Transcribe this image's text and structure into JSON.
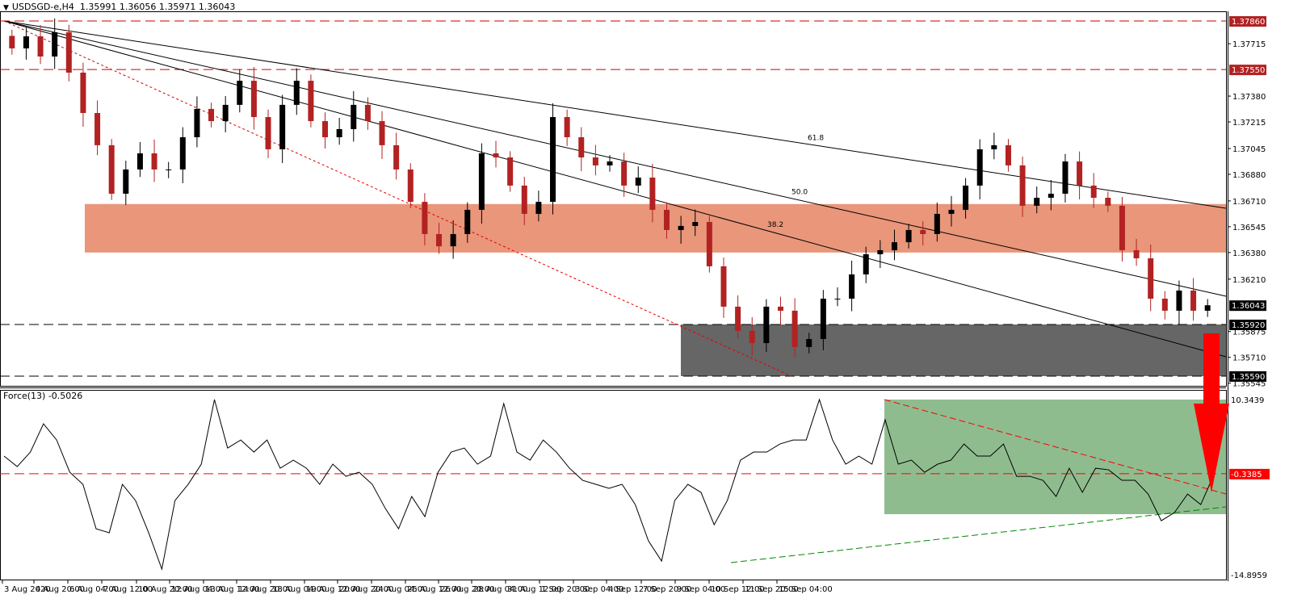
{
  "header": {
    "symbol": "USDSGD-e,H4",
    "ohlc": "1.35991 1.36056 1.35971 1.36043"
  },
  "force_header": "Force(13) -0.5026",
  "colors": {
    "bull": "#000000",
    "bear": "#b22222",
    "resistance_zone": "#e9967a",
    "support_zone": "#666666",
    "force_zone": "#8fbc8f",
    "arrow": "#ff0000"
  },
  "chart_data": [
    {
      "type": "candlestick",
      "title": "USDSGD-e,H4",
      "ylim": [
        1.35545,
        1.3786
      ],
      "y_ticks": [
        "1.37715",
        "1.37380",
        "1.37215",
        "1.37045",
        "1.36880",
        "1.36710",
        "1.36545",
        "1.36380",
        "1.36210",
        "1.35875",
        "1.35710",
        "1.35545"
      ],
      "highlighted_levels": [
        {
          "value": "1.37860",
          "style": "red-dashed"
        },
        {
          "value": "1.37550",
          "style": "red-dashed"
        },
        {
          "value": "1.36043",
          "style": "current-price"
        },
        {
          "value": "1.35920",
          "style": "black-dashed"
        },
        {
          "value": "1.35590",
          "style": "black-dashed"
        }
      ],
      "x_ticks": [
        "3 Aug 2020",
        "4 Aug 20:00",
        "6 Aug 04:00",
        "7 Aug 12:00",
        "10 Aug 20:00",
        "12 Aug 04:00",
        "13 Aug 12:00",
        "14 Aug 20:00",
        "18 Aug 04:00",
        "19 Aug 12:00",
        "20 Aug 20:00",
        "24 Aug 04:00",
        "25 Aug 12:00",
        "26 Aug 20:00",
        "28 Aug 04:00",
        "31 Aug 12:00",
        "1 Sep 20:00",
        "3 Sep 04:00",
        "4 Sep 12:00",
        "7 Sep 20:00",
        "9 Sep 04:00",
        "10 Sep 12:00",
        "11 Sep 20:00",
        "15 Sep 04:00"
      ],
      "fib_labels": [
        "61.8",
        "50.0",
        "38.2"
      ],
      "zones": [
        {
          "name": "resistance",
          "from": 1.3638,
          "to": 1.3669
        },
        {
          "name": "support",
          "from": 1.3559,
          "to": 1.3592
        }
      ],
      "closes": [
        1.37685,
        1.37762,
        1.37633,
        1.37788,
        1.3753,
        1.37272,
        1.37066,
        1.36756,
        1.36911,
        1.37014,
        1.36911,
        1.36911,
        1.37117,
        1.37298,
        1.3722,
        1.37324,
        1.37478,
        1.37246,
        1.3704,
        1.37324,
        1.37478,
        1.3722,
        1.37117,
        1.37169,
        1.37324,
        1.3722,
        1.37066,
        1.36911,
        1.36704,
        1.36498,
        1.3642,
        1.36498,
        1.36653,
        1.37014,
        1.36988,
        1.36808,
        1.36627,
        1.36704,
        1.37246,
        1.37117,
        1.36988,
        1.36937,
        1.36962,
        1.36808,
        1.36859,
        1.36653,
        1.36524,
        1.3655,
        1.36575,
        1.36292,
        1.36034,
        1.35879,
        1.35801,
        1.36034,
        1.36008,
        1.35776,
        1.35827,
        1.36085,
        1.36085,
        1.3624,
        1.36369,
        1.36395,
        1.36446,
        1.36524,
        1.36498,
        1.36627,
        1.36653,
        1.36808,
        1.3704,
        1.37066,
        1.36937,
        1.36679,
        1.3673,
        1.36756,
        1.36962,
        1.36808,
        1.3673,
        1.36679,
        1.36395,
        1.36343,
        1.36085,
        1.36008,
        1.36137,
        1.36008,
        1.36043
      ]
    },
    {
      "type": "line",
      "title": "Force(13)",
      "ylim": [
        -14.8959,
        10.3439
      ],
      "y_ticks": [
        "10.3439",
        "-14.8959"
      ],
      "level": "-0.3385",
      "values": [
        2.2,
        0.69,
        2.78,
        6.85,
        4.52,
        -0.13,
        -1.87,
        -8.27,
        -8.85,
        -1.87,
        -4.2,
        -8.85,
        -14.08,
        -4.2,
        -1.87,
        1.04,
        10.34,
        3.36,
        4.52,
        2.78,
        4.52,
        0.45,
        1.62,
        0.45,
        -1.87,
        1.04,
        -0.71,
        -0.13,
        -1.87,
        -5.36,
        -8.27,
        -3.62,
        -6.52,
        -0.13,
        2.78,
        3.36,
        1.04,
        2.2,
        9.76,
        2.78,
        1.62,
        4.52,
        2.78,
        0.45,
        -1.29,
        -1.87,
        -2.45,
        -1.87,
        -4.78,
        -10.01,
        -12.92,
        -4.2,
        -1.87,
        -3.03,
        -7.69,
        -4.2,
        1.62,
        2.78,
        2.78,
        3.94,
        4.52,
        4.52,
        10.34,
        4.52,
        1.04,
        2.2,
        1.04,
        7.43,
        1.04,
        1.62,
        -0.13,
        1.04,
        1.62,
        3.94,
        2.2,
        2.2,
        3.94,
        -0.71,
        -0.71,
        -1.29,
        -3.62,
        0.45,
        -3.03,
        0.45,
        0.22,
        -1.29,
        -1.29,
        -3.27,
        -7.11,
        -5.94,
        -3.27,
        -4.78,
        -0.5
      ]
    }
  ]
}
